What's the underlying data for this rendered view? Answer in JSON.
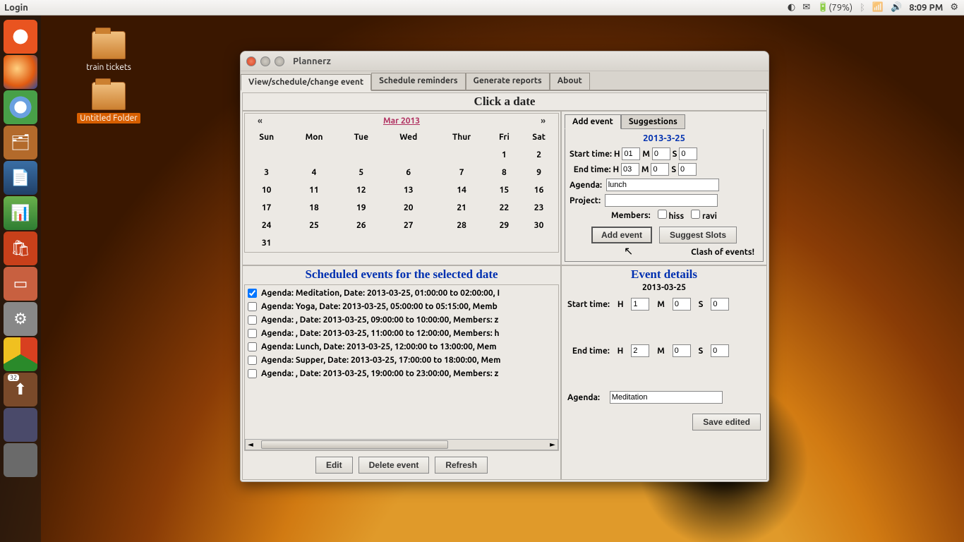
{
  "panel": {
    "title": "Login",
    "battery": "(79%)",
    "clock": "8:09 PM"
  },
  "desktop": {
    "icon1": "train tickets",
    "icon2": "Untitled Folder"
  },
  "launcher": {
    "badge": "32"
  },
  "window": {
    "title": "Plannerz",
    "tabs": [
      "View/schedule/change event",
      "Schedule reminders",
      "Generate reports",
      "About"
    ],
    "click_a_date": "Click a date",
    "scheduled_hdr": "Scheduled events for the selected date",
    "event_details_hdr": "Event details"
  },
  "calendar": {
    "prev": "«",
    "next": "»",
    "month": "Mar 2013",
    "dow": [
      "Sun",
      "Mon",
      "Tue",
      "Wed",
      "Thur",
      "Fri",
      "Sat"
    ],
    "rows": [
      [
        "",
        "",
        "",
        "",
        "",
        "1",
        "2"
      ],
      [
        "3",
        "4",
        "5",
        "6",
        "7",
        "8",
        "9"
      ],
      [
        "10",
        "11",
        "12",
        "13",
        "14",
        "15",
        "16"
      ],
      [
        "17",
        "18",
        "19",
        "20",
        "21",
        "22",
        "23"
      ],
      [
        "24",
        "25",
        "26",
        "27",
        "28",
        "29",
        "30"
      ],
      [
        "31",
        "",
        "",
        "",
        "",
        "",
        ""
      ]
    ]
  },
  "addevent": {
    "tabs": [
      "Add event",
      "Suggestions"
    ],
    "date": "2013-3-25",
    "labels": {
      "start": "Start time:",
      "end": "End time:",
      "H": "H",
      "M": "M",
      "S": "S",
      "agenda": "Agenda:",
      "project": "Project:",
      "members": "Members:"
    },
    "start": {
      "h": "01",
      "m": "0",
      "s": "0"
    },
    "end": {
      "h": "03",
      "m": "0",
      "s": "0"
    },
    "agenda": "lunch",
    "project": "",
    "members": [
      "hiss",
      "ravi"
    ],
    "btn_add": "Add event",
    "btn_suggest": "Suggest Slots",
    "clash": "Clash of events!"
  },
  "events": [
    {
      "checked": true,
      "text": "Agenda: Meditation, Date: 2013-03-25, 01:00:00 to 02:00:00, I"
    },
    {
      "checked": false,
      "text": "Agenda: Yoga, Date: 2013-03-25, 05:00:00 to 05:15:00, Memb"
    },
    {
      "checked": false,
      "text": "Agenda: , Date: 2013-03-25, 09:00:00 to 10:00:00, Members: z"
    },
    {
      "checked": false,
      "text": "Agenda: , Date: 2013-03-25, 11:00:00 to 12:00:00, Members: h"
    },
    {
      "checked": false,
      "text": "Agenda: Lunch, Date: 2013-03-25, 12:00:00 to 13:00:00, Mem"
    },
    {
      "checked": false,
      "text": "Agenda: Supper, Date: 2013-03-25, 17:00:00 to 18:00:00, Mem"
    },
    {
      "checked": false,
      "text": "Agenda: , Date: 2013-03-25, 19:00:00 to 23:00:00, Members: z"
    }
  ],
  "listbtns": {
    "edit": "Edit",
    "delete": "Delete event",
    "refresh": "Refresh"
  },
  "details": {
    "date": "2013-03-25",
    "labels": {
      "start": "Start time:",
      "end": "End time:",
      "H": "H",
      "M": "M",
      "S": "S",
      "agenda": "Agenda:"
    },
    "start": {
      "h": "1",
      "m": "0",
      "s": "0"
    },
    "end": {
      "h": "2",
      "m": "0",
      "s": "0"
    },
    "agenda": "Meditation",
    "save": "Save edited"
  }
}
